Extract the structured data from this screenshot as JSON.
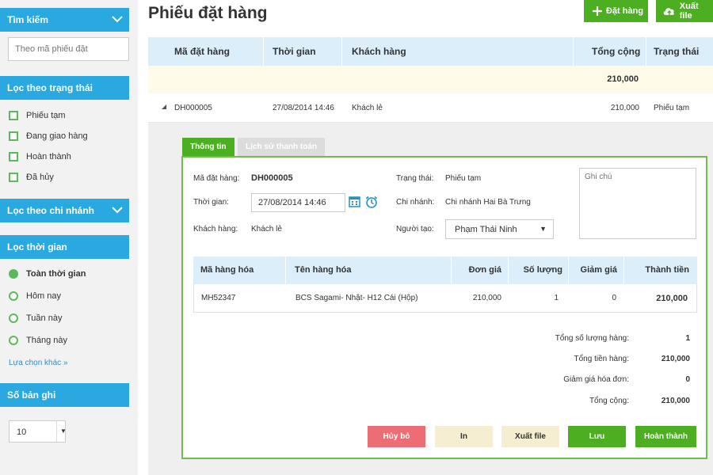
{
  "sidebar": {
    "search_header": "Tìm kiếm",
    "search_placeholder": "Theo mã phiếu đặt",
    "status_header": "Lọc theo trạng thái",
    "statuses": [
      "Phiếu tạm",
      "Đang giao hàng",
      "Hoàn thành",
      "Đã hủy"
    ],
    "branch_header": "Lọc theo chi nhánh",
    "time_header": "Lọc thời gian",
    "time_options": [
      {
        "label": "Toàn thời gian",
        "selected": true
      },
      {
        "label": "Hôm nay",
        "selected": false
      },
      {
        "label": "Tuần này",
        "selected": false
      },
      {
        "label": "Tháng này",
        "selected": false
      }
    ],
    "more_link": "Lựa chọn khác »",
    "records_header": "Số bản ghi",
    "records_value": "10"
  },
  "page": {
    "title": "Phiếu đặt hàng",
    "btn_order": "Đặt hàng",
    "btn_export": "Xuất file"
  },
  "orders_table": {
    "headers": [
      "Mã đặt hàng",
      "Thời gian",
      "Khách hàng",
      "Tổng cộng",
      "Trạng thái"
    ],
    "total": "210,000",
    "row": {
      "code": "DH000005",
      "time": "27/08/2014 14:46",
      "customer": "Khách lẻ",
      "total": "210,000",
      "status": "Phiếu tạm"
    }
  },
  "detail": {
    "tab_info": "Thông tin",
    "tab_payment_history": "Lịch sử thanh toán",
    "label_code": "Mã đặt hàng:",
    "value_code": "DH000005",
    "label_time": "Thời gian:",
    "value_time": "27/08/2014 14:46",
    "label_customer": "Khách hàng:",
    "value_customer": "Khách lẻ",
    "label_status": "Trạng thái:",
    "value_status": "Phiếu tạm",
    "label_branch": "Chi nhánh:",
    "value_branch": "Chi nhánh Hai Bà Trưng",
    "label_creator": "Người tạo:",
    "value_creator": "Phạm Thái Ninh",
    "note_placeholder": "Ghi chú",
    "items_headers": [
      "Mã hàng hóa",
      "Tên hàng hóa",
      "Đơn giá",
      "Số lượng",
      "Giảm giá",
      "Thành tiền"
    ],
    "item": {
      "code": "MH52347",
      "name": "BCS Sagami- Nhật- H12 Cái (Hộp)",
      "price": "210,000",
      "qty": "1",
      "discount": "0",
      "amount": "210,000"
    },
    "summary": [
      {
        "label": "Tổng số lượng hàng:",
        "value": "1"
      },
      {
        "label": "Tổng tiền hàng:",
        "value": "210,000"
      },
      {
        "label": "Giảm giá hóa đơn:",
        "value": "0"
      },
      {
        "label": "Tổng cộng:",
        "value": "210,000"
      }
    ],
    "actions": {
      "cancel": "Hủy bỏ",
      "print": "In",
      "export": "Xuất file",
      "save": "Lưu",
      "complete": "Hoàn thành"
    }
  },
  "colors": {
    "accent_blue": "#29a9e0",
    "green": "#4caf22",
    "red": "#ec6e74"
  }
}
